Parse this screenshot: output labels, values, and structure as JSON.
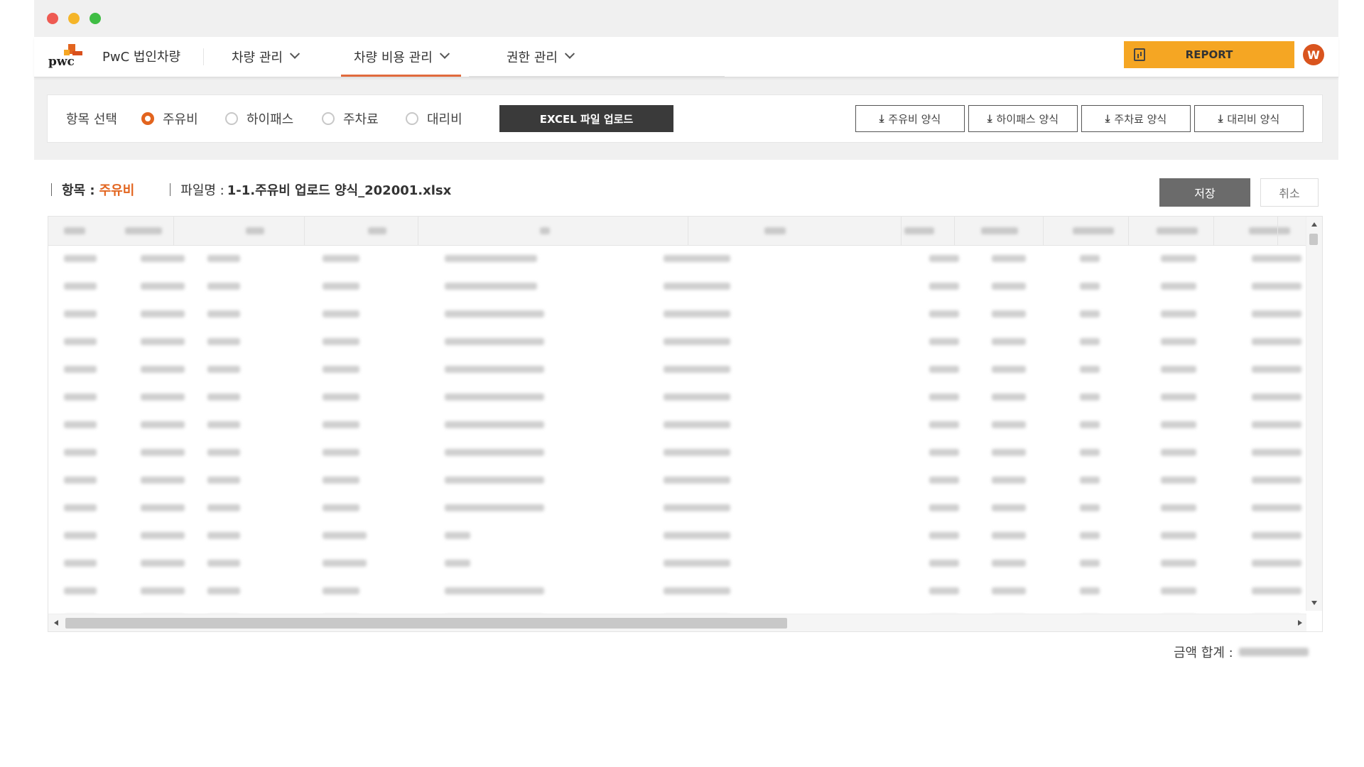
{
  "window": {
    "controls": [
      "close",
      "minimize",
      "maximize"
    ]
  },
  "nav": {
    "app_title": "PwC 법인차량",
    "logo_text": "pwc",
    "items": [
      {
        "label": "차량 관리",
        "active": false
      },
      {
        "label": "차량 비용 관리",
        "active": true
      },
      {
        "label": "권한 관리",
        "active": false
      }
    ],
    "report_label": "REPORT",
    "avatar_initial": "W",
    "accent_color": "#e2641e",
    "report_color": "#f5a623"
  },
  "selector": {
    "label": "항목 선택",
    "options": [
      {
        "label": "주유비",
        "checked": true
      },
      {
        "label": "하이패스",
        "checked": false
      },
      {
        "label": "주차료",
        "checked": false
      },
      {
        "label": "대리비",
        "checked": false
      }
    ],
    "upload_label": "EXCEL 파일 업로드",
    "templates": [
      {
        "label": "주유비 양식",
        "icon": "download-icon"
      },
      {
        "label": "하이패스 양식",
        "icon": "download-icon"
      },
      {
        "label": "주차료 양식",
        "icon": "download-icon"
      },
      {
        "label": "대리비 양식",
        "icon": "download-icon"
      }
    ]
  },
  "info": {
    "item_label": "항목 :",
    "item_value": "주유비",
    "file_label": "파일명 :",
    "file_value": "1-1.주유비 업로드 양식_202001.xlsx",
    "save_label": "저장",
    "cancel_label": "취소"
  },
  "table": {
    "note": "content blurred in screenshot",
    "visible_rows": 14
  },
  "footer": {
    "total_label": "금액 합계 :"
  }
}
